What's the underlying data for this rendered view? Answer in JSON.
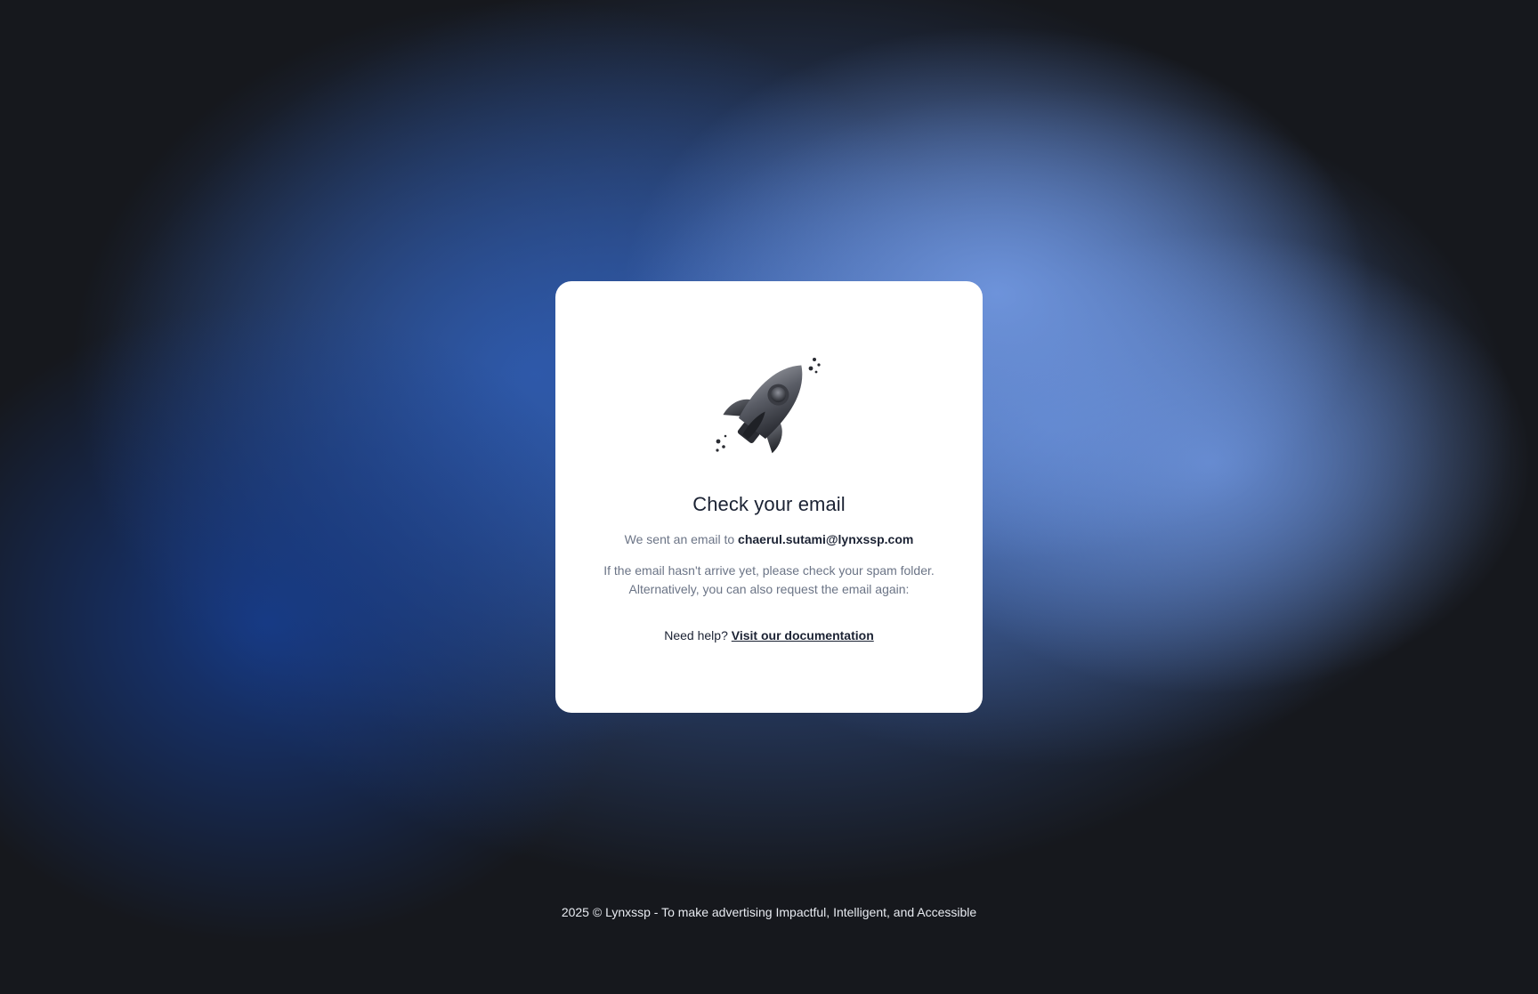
{
  "card": {
    "illustration_icon": "rocket-icon",
    "title": "Check your email",
    "sent_prefix": "We sent an email to",
    "email": "chaerul.sutami@lynxssp.com",
    "hint_line1": "If the email hasn't arrive yet, please check your spam folder.",
    "hint_line2": "Alternatively, you can also request the email again:",
    "help_prefix": "Need help?",
    "help_link": "Visit our documentation"
  },
  "footer": {
    "text": "2025 © Lynxssp - To make advertising Impactful, Intelligent, and Accessible"
  },
  "colors": {
    "background": "#16181d",
    "accent_blue": "#5a84d2",
    "card": "#ffffff",
    "text_primary": "#1b2233",
    "text_muted": "#6b7486"
  }
}
